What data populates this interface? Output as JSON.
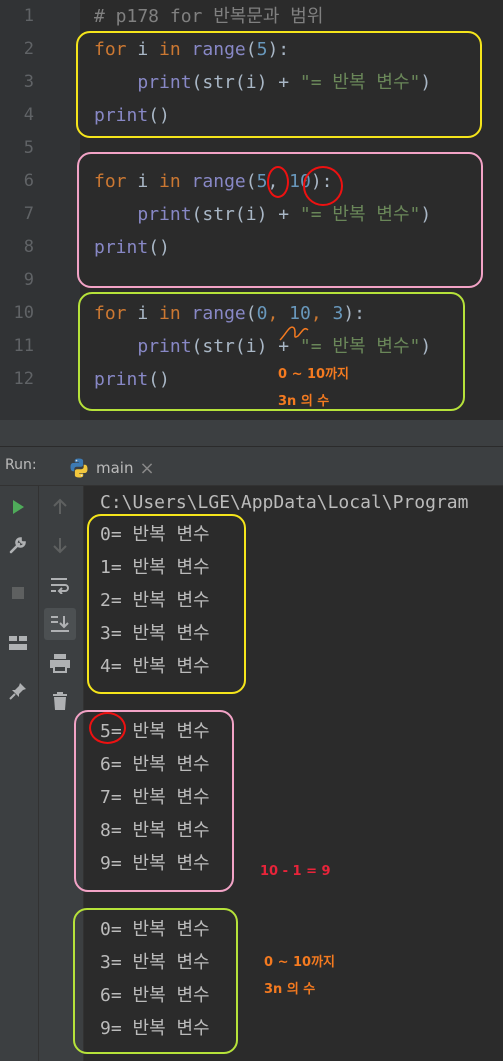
{
  "editor": {
    "line_numbers": [
      "1",
      "2",
      "3",
      "4",
      "5",
      "6",
      "7",
      "8",
      "9",
      "10",
      "11",
      "12"
    ],
    "lines": [
      {
        "comment": "# p178 for 반복문과 범위"
      },
      {
        "kw": "for",
        "var": " i ",
        "kw2": "in",
        "fn": " range",
        "open": "(",
        "args": [
          {
            "t": "5",
            "c": "num"
          }
        ],
        "close": "):"
      },
      {
        "indent": "    ",
        "fn": "print",
        "mid": "(str(i) + ",
        "str": "\"= 반복 변수\"",
        "end": ")"
      },
      {
        "fn": "print",
        "end": "()"
      },
      {},
      {
        "kw": "for",
        "var": " i ",
        "kw2": "in",
        "fn": " range",
        "open": "(",
        "args": [
          {
            "t": "5",
            "c": "num"
          },
          {
            "t": ", ",
            "c": "pl"
          },
          {
            "t": "10",
            "c": "num"
          }
        ],
        "close": "):"
      },
      {
        "indent": "    ",
        "fn": "print",
        "mid": "(str(i) + ",
        "str": "\"= 반복 변수\"",
        "end": ")"
      },
      {
        "fn": "print",
        "end": "()"
      },
      {},
      {
        "kw": "for",
        "var": " i ",
        "kw2": "in",
        "fn": " range",
        "open": "(",
        "args": [
          {
            "t": "0",
            "c": "num"
          },
          {
            "t": ", ",
            "c": "kw"
          },
          {
            "t": "10",
            "c": "num"
          },
          {
            "t": ", ",
            "c": "kw"
          },
          {
            "t": "3",
            "c": "num"
          }
        ],
        "close": "):"
      },
      {
        "indent": "    ",
        "fn": "print",
        "mid": "(str(i) + ",
        "str": "\"= 반복 변수\"",
        "end": ")"
      },
      {
        "fn": "print",
        "end": "()"
      }
    ]
  },
  "annotations": {
    "editor_note_1": "0 ~ 10까지",
    "editor_note_2": "3n 의 수",
    "console_calc": "10 - 1 = 9",
    "console_note_1": "0 ~ 10까지",
    "console_note_2": "3n 의 수"
  },
  "run_panel": {
    "label": "Run:",
    "tab_name": "main",
    "close_glyph": "×",
    "path": "C:\\Users\\LGE\\AppData\\Local\\Program",
    "output_group1": [
      "0= 반복 변수",
      "1= 반복 변수",
      "2= 반복 변수",
      "3= 반복 변수",
      "4= 반복 변수"
    ],
    "output_group2": [
      "5= 반복 변수",
      "6= 반복 변수",
      "7= 반복 변수",
      "8= 반복 변수",
      "9= 반복 변수"
    ],
    "output_group3": [
      "0= 반복 변수",
      "3= 반복 변수",
      "6= 반복 변수",
      "9= 반복 변수"
    ]
  },
  "toolbar_icons": [
    "run-icon",
    "wrench-icon",
    "stop-icon",
    "layout-icon",
    "pin-icon",
    "up-arrow-icon",
    "down-arrow-icon",
    "soft-wrap-icon",
    "scroll-to-end-icon",
    "print-icon",
    "trash-icon"
  ],
  "colors": {
    "background": "#2b2b2b",
    "keyword": "#cc7832",
    "builtin": "#8888c6",
    "number": "#6897bb",
    "string": "#6a8759",
    "yellow_box": "#f5e51b",
    "pink_box": "#f2a3c6",
    "green_box": "#b6e23a",
    "red_circle": "#e11111",
    "orange_note": "#f47a20",
    "red_note": "#e8243a"
  }
}
